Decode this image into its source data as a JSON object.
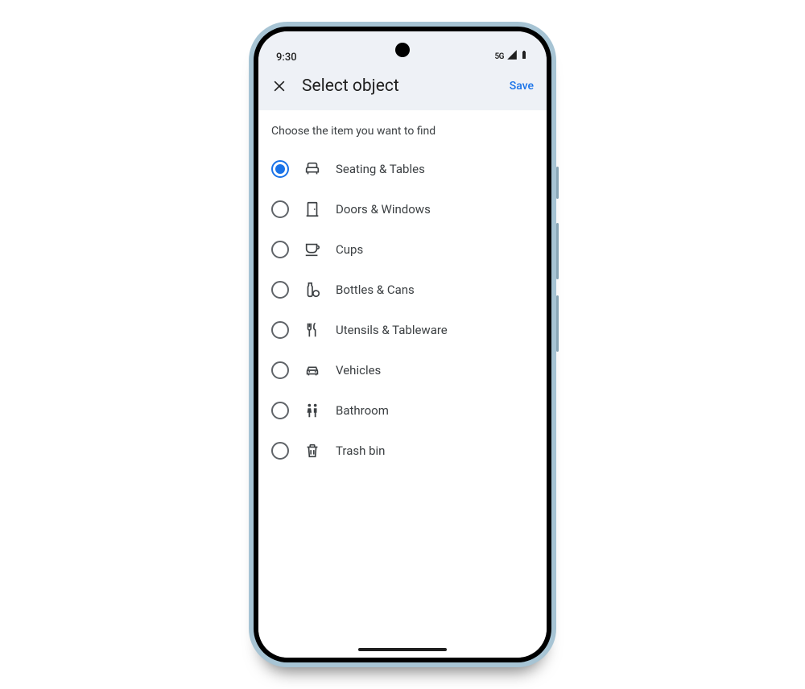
{
  "status": {
    "time": "9:30",
    "network": "5G"
  },
  "appbar": {
    "title": "Select object",
    "save": "Save"
  },
  "instruction": "Choose the item you want to find",
  "options": [
    {
      "label": "Seating & Tables",
      "icon": "chair-icon",
      "selected": true
    },
    {
      "label": "Doors & Windows",
      "icon": "door-icon",
      "selected": false
    },
    {
      "label": "Cups",
      "icon": "cup-icon",
      "selected": false
    },
    {
      "label": "Bottles & Cans",
      "icon": "bottle-icon",
      "selected": false
    },
    {
      "label": "Utensils & Tableware",
      "icon": "utensils-icon",
      "selected": false
    },
    {
      "label": "Vehicles",
      "icon": "vehicle-icon",
      "selected": false
    },
    {
      "label": "Bathroom",
      "icon": "bathroom-icon",
      "selected": false
    },
    {
      "label": "Trash bin",
      "icon": "trash-icon",
      "selected": false
    }
  ]
}
